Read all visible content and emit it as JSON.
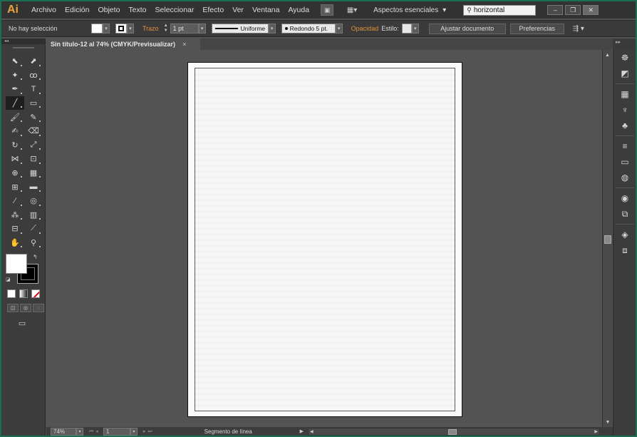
{
  "app": {
    "logo": "Ai",
    "menu": [
      "Archivo",
      "Edición",
      "Objeto",
      "Texto",
      "Seleccionar",
      "Efecto",
      "Ver",
      "Ventana",
      "Ayuda"
    ],
    "workspace": "Aspectos esenciales",
    "search_value": "horizontal",
    "window_controls": [
      "–",
      "❐",
      "✕"
    ]
  },
  "controlbar": {
    "selection_label": "No hay selección",
    "stroke_label": "Trazo",
    "stroke_weight": "1 pt",
    "stroke_profile": "Uniforme",
    "brush": "Redondo 5 pt.",
    "opacity_label": "Opacidad",
    "style_label": "Estilo:",
    "fit_document_button": "Ajustar documento",
    "preferences_button": "Preferencias"
  },
  "document": {
    "tab_title": "Sin título-12 al 74% (CMYK/Previsualizar)",
    "tab_close": "×"
  },
  "statusbar": {
    "zoom": "74%",
    "page": "1",
    "status_text": "Segmento de línea"
  },
  "colors": {
    "accent_orange": "#e0913a",
    "logo_orange": "#e8a33d",
    "frame_green": "#1b6e52",
    "canvas_bg": "#535353"
  },
  "tools": [
    {
      "name": "selection-tool-icon",
      "glyph": "⬉",
      "active": false
    },
    {
      "name": "direct-selection-tool-icon",
      "glyph": "⬈",
      "active": false
    },
    {
      "name": "magic-wand-tool-icon",
      "glyph": "✦",
      "active": false
    },
    {
      "name": "lasso-tool-icon",
      "glyph": "ꝏ",
      "active": false
    },
    {
      "name": "pen-tool-icon",
      "glyph": "✒",
      "active": false
    },
    {
      "name": "type-tool-icon",
      "glyph": "T",
      "active": false
    },
    {
      "name": "line-segment-tool-icon",
      "glyph": "╱",
      "active": true
    },
    {
      "name": "rectangle-tool-icon",
      "glyph": "▭",
      "active": false
    },
    {
      "name": "paintbrush-tool-icon",
      "glyph": "🖌",
      "active": false
    },
    {
      "name": "pencil-tool-icon",
      "glyph": "✎",
      "active": false
    },
    {
      "name": "blob-brush-tool-icon",
      "glyph": "✍",
      "active": false
    },
    {
      "name": "eraser-tool-icon",
      "glyph": "⌫",
      "active": false
    },
    {
      "name": "rotate-tool-icon",
      "glyph": "↻",
      "active": false
    },
    {
      "name": "scale-tool-icon",
      "glyph": "⤢",
      "active": false
    },
    {
      "name": "width-tool-icon",
      "glyph": "⋈",
      "active": false
    },
    {
      "name": "free-transform-tool-icon",
      "glyph": "⊡",
      "active": false
    },
    {
      "name": "shape-builder-tool-icon",
      "glyph": "⊕",
      "active": false
    },
    {
      "name": "perspective-grid-tool-icon",
      "glyph": "▦",
      "active": false
    },
    {
      "name": "mesh-tool-icon",
      "glyph": "⊞",
      "active": false
    },
    {
      "name": "gradient-tool-icon",
      "glyph": "▬",
      "active": false
    },
    {
      "name": "eyedropper-tool-icon",
      "glyph": "⁄",
      "active": false
    },
    {
      "name": "blend-tool-icon",
      "glyph": "◎",
      "active": false
    },
    {
      "name": "symbol-sprayer-tool-icon",
      "glyph": "⁂",
      "active": false
    },
    {
      "name": "column-graph-tool-icon",
      "glyph": "▥",
      "active": false
    },
    {
      "name": "artboard-tool-icon",
      "glyph": "⊟",
      "active": false
    },
    {
      "name": "slice-tool-icon",
      "glyph": "⟋",
      "active": false
    },
    {
      "name": "hand-tool-icon",
      "glyph": "✋",
      "active": false
    },
    {
      "name": "zoom-tool-icon",
      "glyph": "⚲",
      "active": false
    }
  ],
  "right_panels": [
    "color-panel-icon",
    "color-guide-panel-icon",
    "swatches-panel-icon",
    "brushes-panel-icon",
    "symbols-panel-icon",
    "stroke-panel-icon",
    "gradient-panel-icon",
    "transparency-panel-icon",
    "appearance-panel-icon",
    "graphic-styles-panel-icon",
    "layers-panel-icon",
    "artboards-panel-icon"
  ],
  "right_panel_glyphs": [
    "☸",
    "◩",
    "▦",
    "♆",
    "♣",
    "≡",
    "▭",
    "◍",
    "◉",
    "⧉",
    "◈",
    "⧈"
  ]
}
